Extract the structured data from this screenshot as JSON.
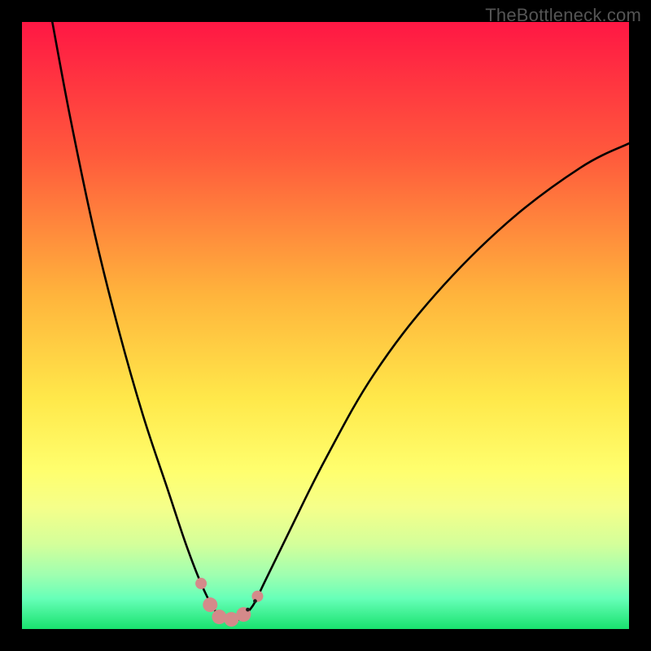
{
  "watermark": "TheBottleneck.com",
  "chart_data": {
    "type": "line",
    "title": "",
    "xlabel": "",
    "ylabel": "",
    "xlim": [
      0,
      100
    ],
    "ylim": [
      0,
      100
    ],
    "gradient_stops": [
      {
        "offset": 0,
        "color": "#ff1744"
      },
      {
        "offset": 22,
        "color": "#ff5a3c"
      },
      {
        "offset": 45,
        "color": "#ffb43c"
      },
      {
        "offset": 62,
        "color": "#ffe84a"
      },
      {
        "offset": 74,
        "color": "#ffff6e"
      },
      {
        "offset": 80,
        "color": "#f5ff8a"
      },
      {
        "offset": 86,
        "color": "#d4ff9a"
      },
      {
        "offset": 91,
        "color": "#a0ffb0"
      },
      {
        "offset": 95,
        "color": "#66ffb8"
      },
      {
        "offset": 100,
        "color": "#19e26e"
      }
    ],
    "series": [
      {
        "name": "bottleneck-curve",
        "x": [
          5,
          8,
          12,
          16,
          20,
          24,
          27,
          29.5,
          31.5,
          33,
          34.5,
          36,
          38,
          40,
          44,
          50,
          58,
          68,
          80,
          92,
          100
        ],
        "y": [
          100,
          84,
          65,
          49,
          35,
          23,
          14,
          7.5,
          3.5,
          1.8,
          1.2,
          1.8,
          3.8,
          7.8,
          16,
          28,
          42,
          55,
          67,
          76,
          80
        ]
      }
    ],
    "markers": {
      "name": "highlight-dots",
      "color": "#d48a8a",
      "radius_small": 7,
      "radius_large": 9,
      "points": [
        {
          "x": 29.5,
          "y": 7.5
        },
        {
          "x": 31.0,
          "y": 4.0,
          "large": true
        },
        {
          "x": 32.5,
          "y": 2.0,
          "large": true
        },
        {
          "x": 34.5,
          "y": 1.6,
          "large": true
        },
        {
          "x": 36.5,
          "y": 2.4,
          "large": true
        },
        {
          "x": 38.8,
          "y": 5.4
        }
      ]
    },
    "dark_dots": {
      "color": "#1a1a1a",
      "radius": 2.4,
      "points": [
        {
          "x": 37.2,
          "y": 3.2
        },
        {
          "x": 38.4,
          "y": 4.6
        }
      ]
    }
  }
}
